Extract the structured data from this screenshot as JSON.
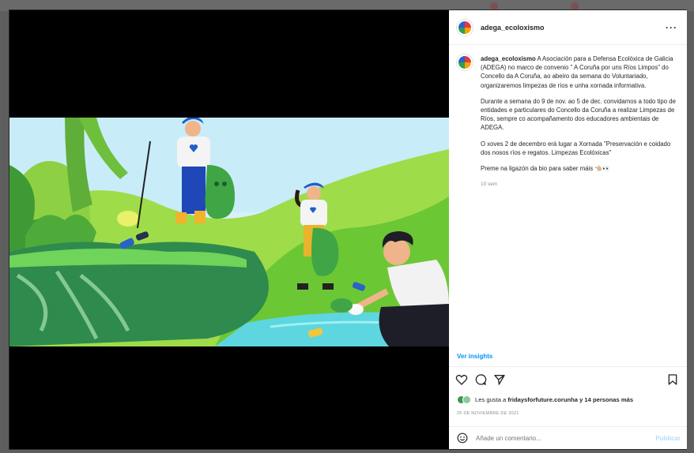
{
  "post": {
    "username": "adega_ecoloxismo",
    "more_label": "···",
    "caption_paragraphs": [
      "A Asociación para a Defensa Ecolóxica de Galicia (ADEGA) no marco de convenio \" A Coruña por uns Ríos Limpos\" do Concello da A Coruña, ao abeiro da semana do Voluntariado, organizaremos limpezas de ríos e unha xornada informativa.",
      "Durante a semana do 9 de nov. ao 5 de dec. convidamos a todo tipo de entidades e particulares do Concello da Coruña a realizar Limpezas de Ríos, sempre co acompañamento dos educadores ambientais de ADEGA.",
      "O xoves 2 de decembro erá lugar a Xornada \"Preservación e coidado dos nosos ríos e regatos. Limpezas Ecolóxicas\"",
      "Preme na ligazón da bio para saber máis 👈🏼👀"
    ],
    "time_ago": "10 sem",
    "insights_label": "Ver insights",
    "likes_text_prefix": "Les gusta a ",
    "likes_user": "fridaysforfuture.corunha",
    "likes_text_suffix": " y 14 personas más",
    "date": "25 DE NOVIEMBRE DE 2021",
    "comment_placeholder": "Añade un comentario...",
    "publish_label": "Publicar"
  },
  "icons": {
    "like": "heart-icon",
    "comment": "comment-icon",
    "share": "send-icon",
    "save": "bookmark-icon",
    "emoji": "emoji-icon"
  },
  "colors": {
    "link_blue": "#0095f6",
    "publish_disabled": "#b3dbff",
    "text": "#262626",
    "muted": "#8e8e8e"
  }
}
